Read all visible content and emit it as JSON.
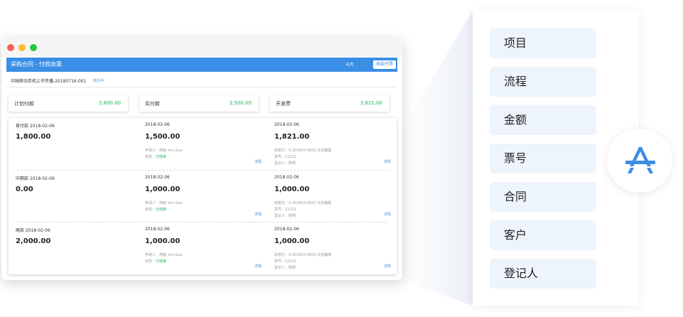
{
  "app": {
    "title": "采购合同 - 付款收票",
    "card_label": "卡片",
    "action_button": "收款开票",
    "project_name": "中国移动手机上市传播-20180716-001",
    "project_status": "执行中"
  },
  "summary": [
    {
      "label": "计划付款",
      "value": "3,800.00"
    },
    {
      "label": "实付款",
      "value": "2,500.00"
    },
    {
      "label": "开发票",
      "value": "3,821.00"
    }
  ],
  "rows": [
    {
      "plan": {
        "date": "首付款  2018-02-06",
        "amount": "1,800.00"
      },
      "paid": {
        "date": "2018-02-06",
        "amount": "1,500.00",
        "applicant": "申请人：高敏 min.Gao",
        "status_label": "状态：",
        "status": "已结束",
        "detail": "详情"
      },
      "invoice": {
        "date": "2018-02-06",
        "amount": "1,821.00",
        "payee": "收款方：S-201803-0001 北京巍斌",
        "number": "票号：11111",
        "registrar": "登记人：陈明",
        "detail": "详情"
      }
    },
    {
      "plan": {
        "date": "中期款  2018-02-06",
        "amount": "0.00"
      },
      "paid": {
        "date": "2018-02-06",
        "amount": "1,000.00",
        "applicant": "申请人：高敏 min.Gao",
        "status_label": "状态：",
        "status": "已结束",
        "detail": "详情"
      },
      "invoice": {
        "date": "2018-02-06",
        "amount": "1,000.00",
        "payee": "收款方：S-201803-0001 北京巍斌",
        "number": "票号：11111",
        "registrar": "登记人：陈明",
        "detail": "详情"
      }
    },
    {
      "plan": {
        "date": "尾款  2018-02-06",
        "amount": "2,000.00"
      },
      "paid": {
        "date": "2018-02-06",
        "amount": "1,000.00",
        "applicant": "申请人：高敏 min.Gao",
        "status_label": "状态：",
        "status": "已结束",
        "detail": "详情"
      },
      "invoice": {
        "date": "2018-02-06",
        "amount": "1,000.00",
        "payee": "收款方：S-201803-0001 北京巍斌",
        "number": "票号：11111",
        "registrar": "登记人：陈明",
        "detail": "详情"
      }
    }
  ],
  "menu": [
    "项目",
    "流程",
    "金额",
    "票号",
    "合同",
    "客户",
    "登记人"
  ],
  "badge_icon": "app-store-icon",
  "colors": {
    "accent": "#3a8ee6",
    "positive": "#22b35d",
    "menu_bg": "#eef4fb"
  }
}
